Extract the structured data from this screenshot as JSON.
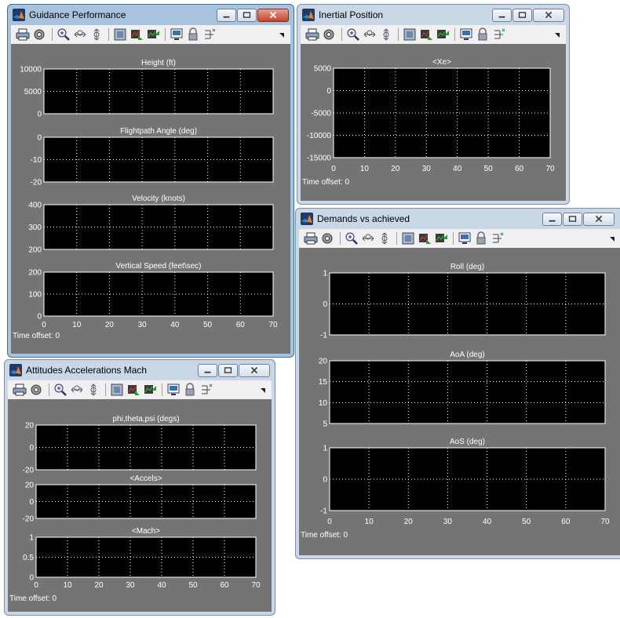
{
  "windows": [
    {
      "id": "guidance-performance",
      "title": "Guidance Performance",
      "active": true,
      "time_offset": "Time offset:  0",
      "xlim": [
        0,
        70
      ],
      "xticks": [
        0,
        10,
        20,
        30,
        40,
        50,
        60,
        70
      ],
      "axes": [
        {
          "title": "Height (ft)",
          "ylim": [
            0,
            10000
          ],
          "yticks": [
            0,
            5000,
            10000
          ]
        },
        {
          "title": "Flightpath Angle (deg)",
          "ylim": [
            -20,
            0
          ],
          "yticks": [
            -20,
            -10,
            0
          ]
        },
        {
          "title": "Velocity (knots)",
          "ylim": [
            200,
            400
          ],
          "yticks": [
            200,
            300,
            400
          ]
        },
        {
          "title": "Vertical Speed (feet\\sec)",
          "ylim": [
            0,
            200
          ],
          "yticks": [
            0,
            100,
            200
          ]
        }
      ]
    },
    {
      "id": "inertial-position",
      "title": "Inertial Position",
      "active": false,
      "time_offset": "Time offset:  0",
      "xlim": [
        0,
        70
      ],
      "xticks": [
        0,
        10,
        20,
        30,
        40,
        50,
        60,
        70
      ],
      "axes": [
        {
          "title": "<Xe>",
          "ylim": [
            -15000,
            5000
          ],
          "yticks": [
            -15000,
            -10000,
            -5000,
            0,
            5000
          ]
        }
      ]
    },
    {
      "id": "demands-vs-achieved",
      "title": "Demands vs achieved",
      "active": false,
      "time_offset": "Time offset:  0",
      "xlim": [
        0,
        70
      ],
      "xticks": [
        0,
        10,
        20,
        30,
        40,
        50,
        60,
        70
      ],
      "axes": [
        {
          "title": "Roll (deg)",
          "ylim": [
            -1,
            1
          ],
          "yticks": [
            -1,
            0,
            1
          ]
        },
        {
          "title": "AoA (deg)",
          "ylim": [
            5,
            20
          ],
          "yticks": [
            5,
            10,
            15,
            20
          ]
        },
        {
          "title": "AoS (deg)",
          "ylim": [
            -1,
            1
          ],
          "yticks": [
            -1,
            0,
            1
          ]
        }
      ]
    },
    {
      "id": "attitudes-accelerations-mach",
      "title": "Attitudes Accelerations Mach",
      "active": false,
      "time_offset": "Time offset:  0",
      "xlim": [
        0,
        70
      ],
      "xticks": [
        0,
        10,
        20,
        30,
        40,
        50,
        60,
        70
      ],
      "axes": [
        {
          "title": "phi,theta,psi (degs)",
          "ylim": [
            -20,
            20
          ],
          "yticks": [
            -20,
            0,
            20
          ]
        },
        {
          "title": "<Accels>",
          "ylim": [
            -20,
            20
          ],
          "yticks": [
            -20,
            0,
            20
          ]
        },
        {
          "title": "<Mach>",
          "ylim": [
            0,
            1
          ],
          "yticks": [
            0,
            0.5,
            1
          ]
        }
      ]
    }
  ],
  "toolbar_icons": [
    "print-icon",
    "parameters-icon",
    "zoom-icon",
    "zoom-x-icon",
    "zoom-y-icon",
    "autoscale-icon",
    "save-axes-icon",
    "restore-axes-icon",
    "floating-scope-icon",
    "lock-axes-icon",
    "signal-selection-icon",
    "toolbar-arrow-icon"
  ],
  "colors": {
    "plot_bg": "#000000",
    "figure_bg": "#747474",
    "grid": "#ffffff",
    "active_frame": "#a9c3de",
    "inactive_frame": "#c9d7e7",
    "close_active": "#c7432c"
  }
}
